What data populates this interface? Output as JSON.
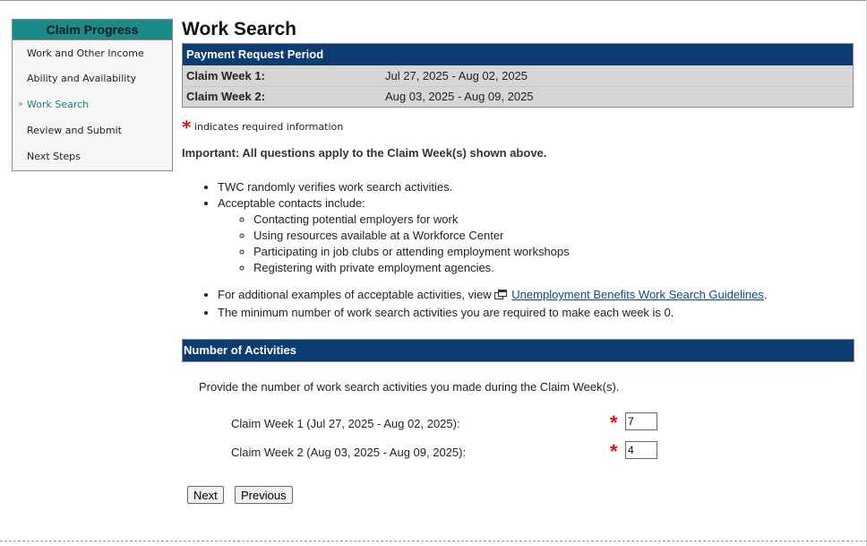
{
  "sidebar": {
    "title": "Claim Progress",
    "items": [
      {
        "label": "Work and Other Income"
      },
      {
        "label": "Ability and Availability"
      },
      {
        "label": "Work Search"
      },
      {
        "label": "Review and Submit"
      },
      {
        "label": "Next Steps"
      }
    ],
    "active_marker": "»"
  },
  "page": {
    "title": "Work Search"
  },
  "payment_period": {
    "header": "Payment Request Period",
    "rows": [
      {
        "label": "Claim Week 1:",
        "value": "Jul 27, 2025 - Aug 02, 2025"
      },
      {
        "label": "Claim Week 2:",
        "value": "Aug 03, 2025 - Aug 09, 2025"
      }
    ]
  },
  "required_note": {
    "star": "*",
    "text": "indicates required information"
  },
  "important": "Important: All questions apply to the Claim Week(s) shown above.",
  "info": {
    "bullet_1": "TWC randomly verifies work search activities.",
    "bullet_2": "Acceptable contacts include:",
    "contacts": [
      "Contacting potential employers for work",
      "Using resources available at a Workforce Center",
      "Participating in job clubs or attending employment workshops",
      "Registering with private employment agencies."
    ],
    "examples_prefix": "For additional examples of acceptable activities, view",
    "examples_link": "Unemployment Benefits Work Search Guidelines",
    "examples_suffix": ".",
    "minimum": "The minimum number of work search activities you are required to make each week is 0."
  },
  "activities": {
    "header": "Number of Activities",
    "intro": "Provide the number of work search activities you made during the Claim Week(s).",
    "week1_label": "Claim Week 1 (Jul 27, 2025 - Aug 02, 2025):",
    "week1_value": "7",
    "week2_label": "Claim Week 2 (Aug 03, 2025 - Aug 09, 2025):",
    "week2_value": "4",
    "star": "*"
  },
  "buttons": {
    "next": "Next",
    "previous": "Previous"
  },
  "colors": {
    "sidebar_header": "#1d8a8a",
    "section_header": "#0d3c70",
    "required": "#e31010",
    "link": "#0b4b7c",
    "active_item": "#1d7f8a"
  }
}
